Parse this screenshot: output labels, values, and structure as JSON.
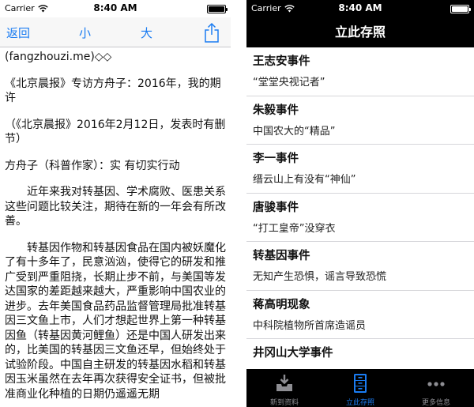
{
  "left": {
    "status": {
      "carrier": "Carrier",
      "time": "8:40 AM"
    },
    "nav": {
      "back_label": "返回",
      "small_label": "小",
      "large_label": "大"
    },
    "article": {
      "paragraphs": [
        "(fangzhouzi.me)◇◇",
        "《北京晨报》专访方舟子：2016年，我的期许",
        "（《北京晨报》2016年2月12日，发表时有删节）",
        "方舟子（科普作家）：实 有切实行动",
        "近年来我对转基因、学术腐败、医患关系这些问题比较关注，期待在新的一年会有所改善。",
        "转基因作物和转基因食品在国内被妖魔化了有十多年了，民意汹汹，使得它的研发和推广受到严重阻挠，长期止步不前，与美国等发达国家的差距越来越大，严重影响中国农业的进步。去年美国食品药品监督管理局批准转基因三文鱼上市，人们才想起世界上第一种转基因鱼（转基因黄河鲤鱼）还是中国人研发出来的，比美国的转基因三文鱼还早，但始终处于试验阶段。中国自主研发的转基因水稻和转基因玉米虽然在去年再次获得安全证书，但被批准商业化种植的日期仍遥遥无期"
      ]
    }
  },
  "right": {
    "status": {
      "carrier": "Carrier",
      "time": "8:40 AM"
    },
    "nav": {
      "title": "立此存照"
    },
    "events": [
      {
        "title": "王志安事件",
        "subtitle": "“堂堂央视记者”"
      },
      {
        "title": "朱毅事件",
        "subtitle": "中国农大的“精品”"
      },
      {
        "title": "李一事件",
        "subtitle": "缙云山上有没有“神仙”"
      },
      {
        "title": "唐骏事件",
        "subtitle": "“打工皇帝”没穿衣"
      },
      {
        "title": "转基因事件",
        "subtitle": "无知产生恐惧，谣言导致恐慌"
      },
      {
        "title": "蒋高明现象",
        "subtitle": "中科院植物所首席造谣员"
      },
      {
        "title": "井冈山大学事件",
        "subtitle": ""
      }
    ],
    "tabs": [
      {
        "label": "新到资料",
        "icon": "inbox-download-icon"
      },
      {
        "label": "立此存照",
        "icon": "archive-drawers-icon"
      },
      {
        "label": "更多信息",
        "icon": "more-dots-icon"
      }
    ],
    "active_tab": 1
  },
  "colors": {
    "accent": "#1a7cf2",
    "tabbar": "#000000",
    "inactive": "#8e8e93"
  }
}
